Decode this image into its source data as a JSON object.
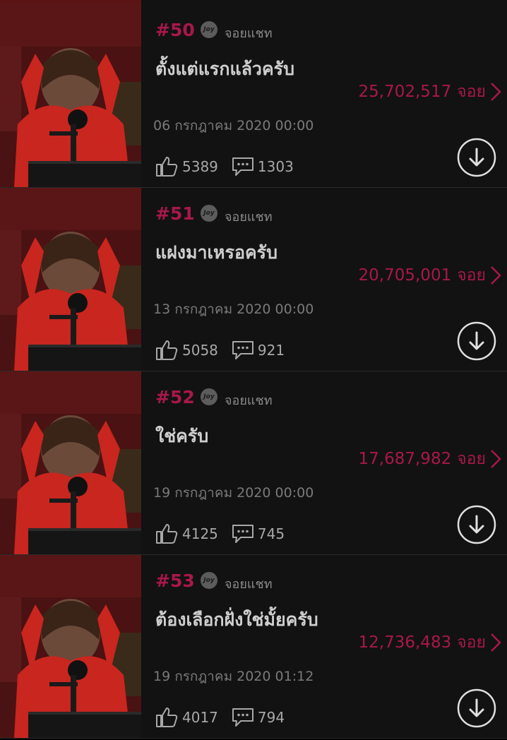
{
  "channel_name": "จอยแชท",
  "joy_badge_text": "Joy",
  "count_unit": "จอย",
  "colors": {
    "background": "#121212",
    "accent": "#a8184a",
    "text_secondary": "#7a7a7a",
    "title": "#cfcfcf"
  },
  "episodes": [
    {
      "number": "#50",
      "title": "ตั้งแต่แรกแล้วครับ",
      "count": "25,702,517",
      "date": "06 กรกฎาคม 2020 00:00",
      "likes": "5389",
      "comments": "1303"
    },
    {
      "number": "#51",
      "title": "แฝงมาเหรอครับ",
      "count": "20,705,001",
      "date": "13 กรกฎาคม 2020 00:00",
      "likes": "5058",
      "comments": "921"
    },
    {
      "number": "#52",
      "title": "ใช่ครับ",
      "count": "17,687,982",
      "date": "19 กรกฎาคม 2020 00:00",
      "likes": "4125",
      "comments": "745"
    },
    {
      "number": "#53",
      "title": "ต้องเลือกฝั่งใช่มั้ยครับ",
      "count": "12,736,483",
      "date": "19 กรกฎาคม 2020 01:12",
      "likes": "4017",
      "comments": "794"
    }
  ]
}
